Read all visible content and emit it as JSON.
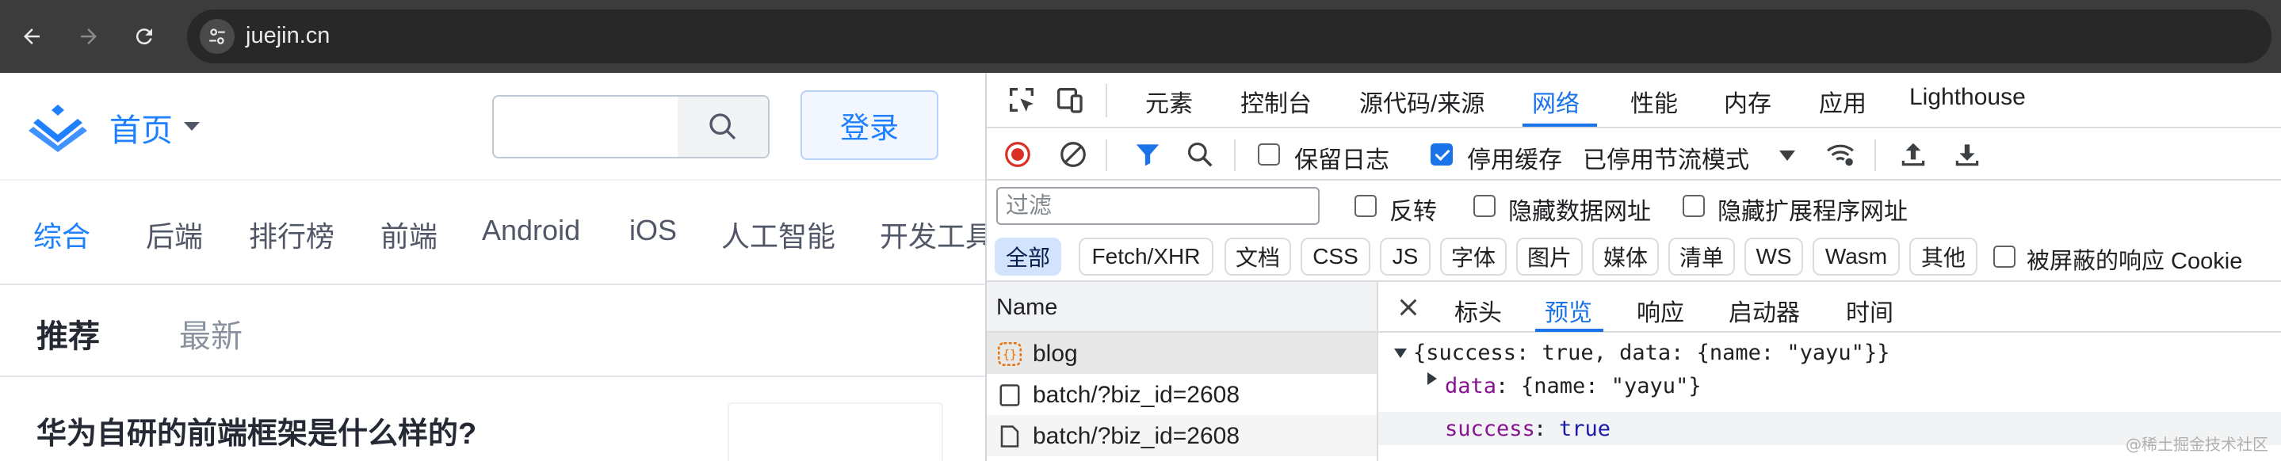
{
  "browser": {
    "url": "juejin.cn"
  },
  "page": {
    "home_label": "首页",
    "login_label": "登录",
    "categories": [
      "综合",
      "后端",
      "排行榜",
      "前端",
      "Android",
      "iOS",
      "人工智能",
      "开发工具"
    ],
    "feed_tabs": [
      "推荐",
      "最新"
    ],
    "article_title": "华为自研的前端框架是什么样的?",
    "brand_color": "#1e80ff"
  },
  "devtools": {
    "tabs": [
      "元素",
      "控制台",
      "源代码/来源",
      "网络",
      "性能",
      "内存",
      "应用",
      "Lighthouse"
    ],
    "active_tab": "网络",
    "toolbar": {
      "preserve_log": "保留日志",
      "disable_cache": "停用缓存",
      "throttling": "已停用节流模式"
    },
    "filter": {
      "placeholder": "过滤",
      "invert": "反转",
      "hide_data_urls": "隐藏数据网址",
      "hide_extension_urls": "隐藏扩展程序网址"
    },
    "type_filters": [
      "全部",
      "Fetch/XHR",
      "文档",
      "CSS",
      "JS",
      "字体",
      "图片",
      "媒体",
      "清单",
      "WS",
      "Wasm",
      "其他"
    ],
    "blocked_cookies": "被屏蔽的响应 Cookie",
    "name_header": "Name",
    "requests": [
      {
        "name": "blog",
        "icon": "xhr-icon"
      },
      {
        "name": "batch/?biz_id=2608",
        "icon": "document-icon"
      },
      {
        "name": "batch/?biz_id=2608",
        "icon": "document-icon"
      }
    ],
    "detail_tabs": [
      "标头",
      "预览",
      "响应",
      "启动器",
      "时间"
    ],
    "active_detail_tab": "预览",
    "preview": {
      "line1": "{success: true, data: {name: \"yayu\"}}",
      "data_key": "data",
      "data_value": "{name: \"yayu\"}",
      "success_key": "success",
      "success_value": "true"
    }
  },
  "watermark": "@稀土掘金技术社区"
}
